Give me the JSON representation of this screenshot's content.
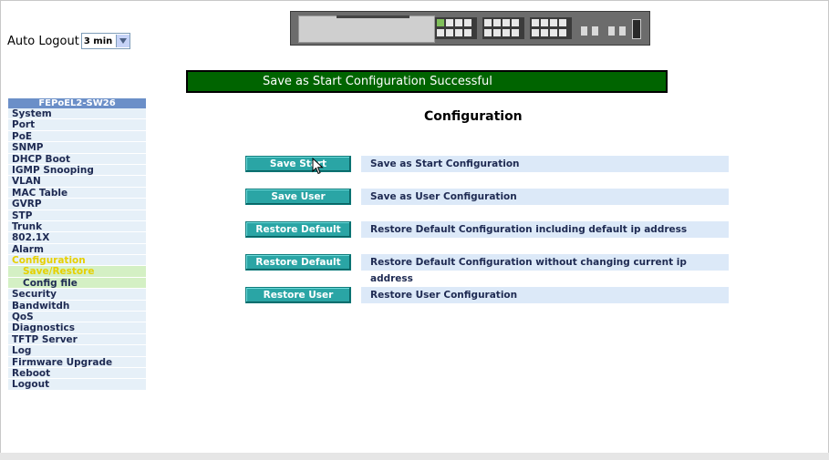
{
  "auto_logout": {
    "label": "Auto Logout",
    "value": "3 min"
  },
  "banner": {
    "text": "Save as Start Configuration Successful"
  },
  "sidebar": {
    "title": "FEPoEL2-SW26",
    "items": [
      {
        "label": "System"
      },
      {
        "label": "Port"
      },
      {
        "label": "PoE"
      },
      {
        "label": "SNMP"
      },
      {
        "label": "DHCP Boot"
      },
      {
        "label": "IGMP Snooping"
      },
      {
        "label": "VLAN"
      },
      {
        "label": "MAC Table"
      },
      {
        "label": "GVRP"
      },
      {
        "label": "STP"
      },
      {
        "label": "Trunk"
      },
      {
        "label": "802.1X"
      },
      {
        "label": "Alarm"
      },
      {
        "label": "Configuration"
      },
      {
        "label": "Save/Restore"
      },
      {
        "label": "Config file"
      },
      {
        "label": "Security"
      },
      {
        "label": "Bandwitdh"
      },
      {
        "label": "QoS"
      },
      {
        "label": "Diagnostics"
      },
      {
        "label": "TFTP Server"
      },
      {
        "label": "Log"
      },
      {
        "label": "Firmware Upgrade"
      },
      {
        "label": "Reboot"
      },
      {
        "label": "Logout"
      }
    ]
  },
  "main": {
    "title": "Configuration",
    "rows": [
      {
        "button": "Save Start",
        "desc": "Save as Start Configuration"
      },
      {
        "button": "Save User",
        "desc": "Save as User Configuration"
      },
      {
        "button": "Restore Default",
        "desc": "Restore Default Configuration including default ip address"
      },
      {
        "button": "Restore Default",
        "desc": "Restore Default Configuration without changing current ip address"
      },
      {
        "button": "Restore User",
        "desc": "Restore User Configuration"
      }
    ]
  }
}
